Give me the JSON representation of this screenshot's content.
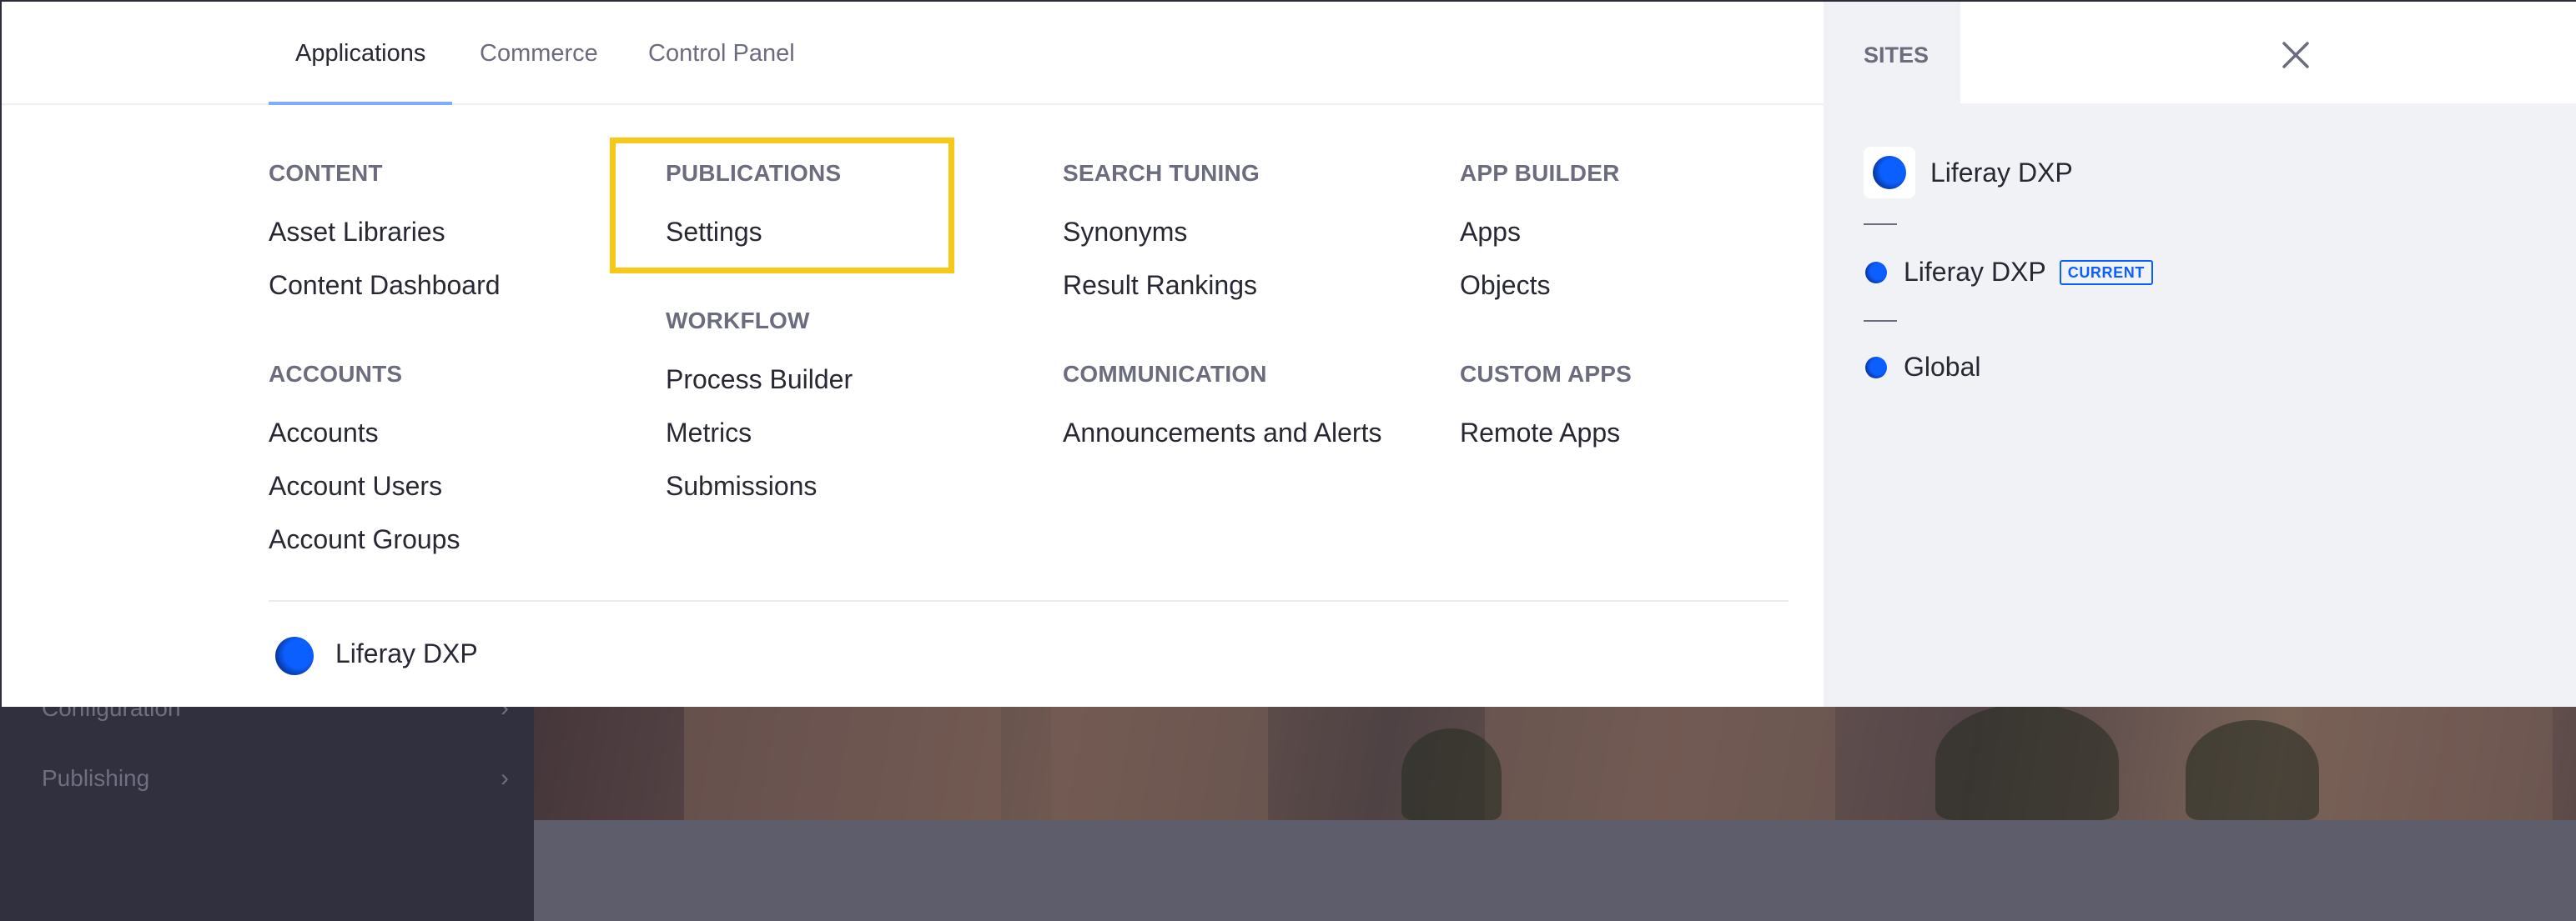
{
  "background": {
    "sidebar_items": [
      {
        "label": "Configuration"
      },
      {
        "label": "Publishing"
      }
    ]
  },
  "tabs": [
    {
      "label": "Applications",
      "active": true
    },
    {
      "label": "Commerce",
      "active": false
    },
    {
      "label": "Control Panel",
      "active": false
    }
  ],
  "columns": {
    "content": {
      "title": "CONTENT",
      "items": [
        "Asset Libraries",
        "Content Dashboard"
      ]
    },
    "accounts": {
      "title": "ACCOUNTS",
      "items": [
        "Accounts",
        "Account Users",
        "Account Groups"
      ]
    },
    "publications": {
      "title": "PUBLICATIONS",
      "items": [
        "Settings"
      ]
    },
    "workflow": {
      "title": "WORKFLOW",
      "items": [
        "Process Builder",
        "Metrics",
        "Submissions"
      ]
    },
    "search_tuning": {
      "title": "SEARCH TUNING",
      "items": [
        "Synonyms",
        "Result Rankings"
      ]
    },
    "communication": {
      "title": "COMMUNICATION",
      "items": [
        "Announcements and Alerts"
      ]
    },
    "app_builder": {
      "title": "APP BUILDER",
      "items": [
        "Apps",
        "Objects"
      ]
    },
    "custom_apps": {
      "title": "CUSTOM APPS",
      "items": [
        "Remote Apps"
      ]
    }
  },
  "footer": {
    "site_name": "Liferay DXP"
  },
  "sites": {
    "tab_label": "SITES",
    "items": [
      {
        "name": "Liferay DXP"
      },
      {
        "name": "Liferay DXP",
        "badge": "CURRENT"
      },
      {
        "name": "Global"
      }
    ]
  },
  "colors": {
    "accent": "#80acff",
    "highlight": "#f7c71a",
    "brand": "#0b5fff"
  }
}
